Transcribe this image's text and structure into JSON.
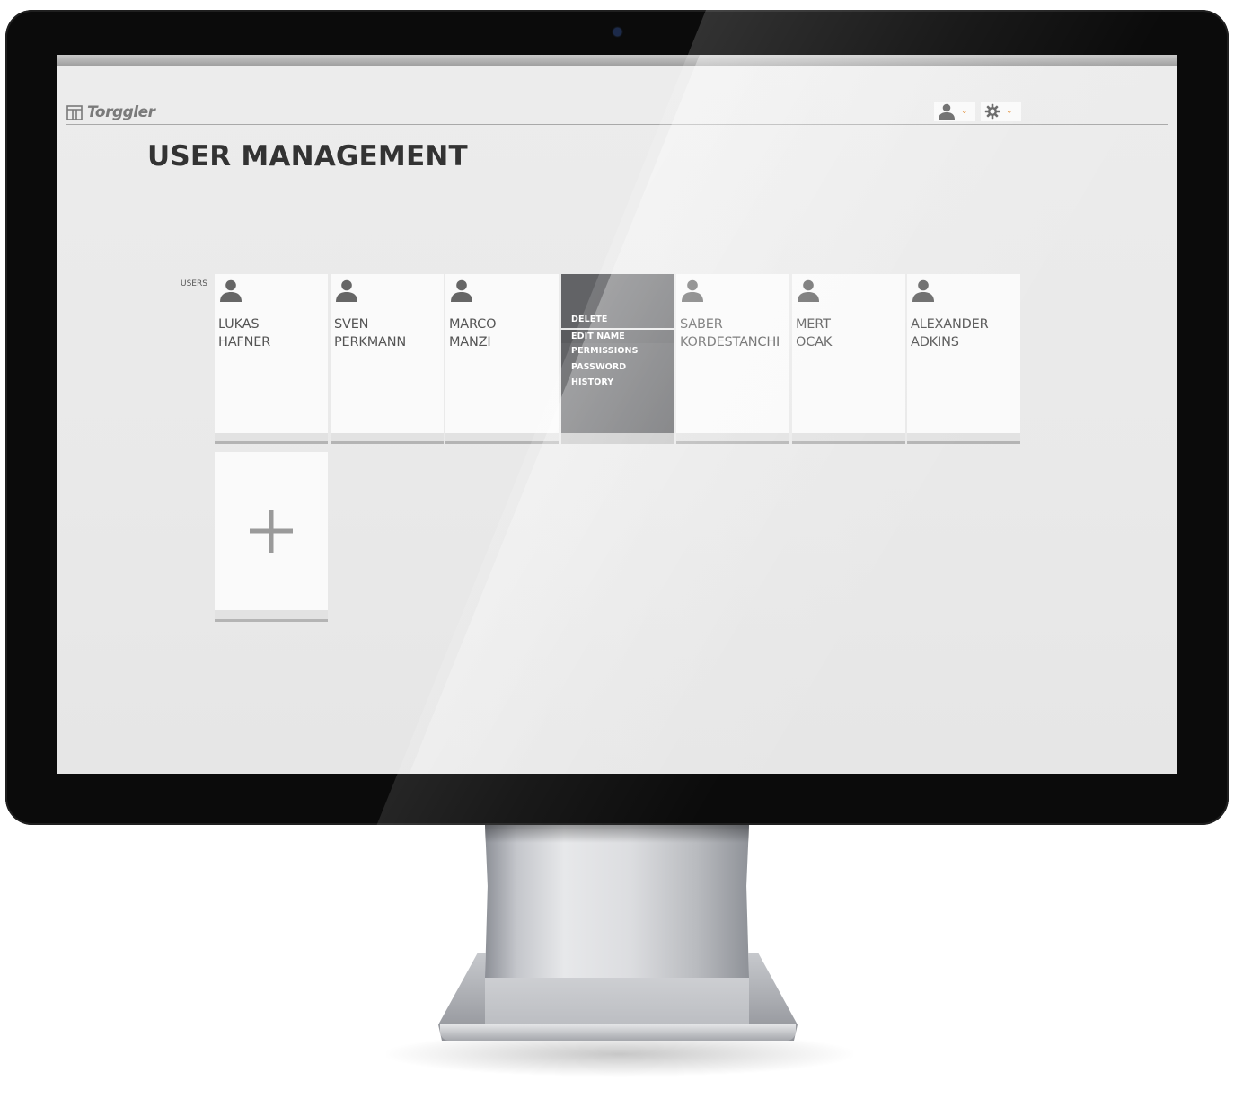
{
  "app": {
    "logo_text": "Torggler",
    "page_title": "USER MANAGEMENT"
  },
  "header": {
    "user_menu_icon": "user-icon",
    "settings_menu_icon": "gear-icon",
    "chevron_icon": "chevron-down-icon",
    "chevron_glyph": "⌄",
    "accent_color": "#e0892f"
  },
  "users": {
    "section_label": "USERS",
    "cards": [
      {
        "first": "LUKAS",
        "last": "HAFNER"
      },
      {
        "first": "SVEN",
        "last": "PERKMANN"
      },
      {
        "first": "MARCO",
        "last": "MANZI"
      },
      {
        "first": "",
        "last": ""
      },
      {
        "first": "SABER",
        "last": "KORDESTANCHI"
      },
      {
        "first": "MERT",
        "last": "OCAK"
      },
      {
        "first": "ALEXANDER",
        "last": "ADKINS"
      }
    ],
    "active_card_menu": [
      "DELETE",
      "EDIT NAME",
      "PERMISSIONS",
      "PASSWORD",
      "HISTORY"
    ],
    "highlighted_menu_item": "EDIT NAME",
    "add_icon": "plus-icon",
    "active_card_color": "#626366"
  }
}
